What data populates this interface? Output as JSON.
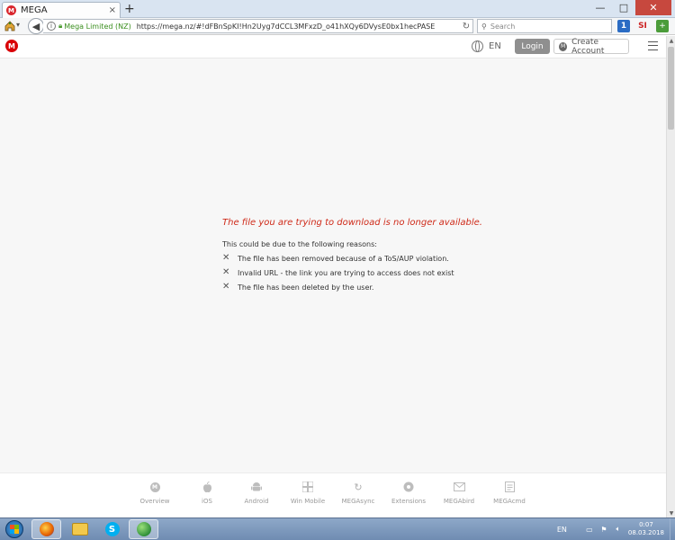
{
  "browser": {
    "tab_title": "MEGA",
    "tab_close": "×",
    "new_tab": "+",
    "window_controls": {
      "minimize": "—",
      "maximize": "□",
      "close": "✕"
    },
    "identity": "Mega Limited (NZ)",
    "url": "https://mega.nz/#!dFBnSpKI!Hn2Uyg7dCCL3MFxzD_o41hXQy6DVysE0bx1hecPASE",
    "search_placeholder": "Search",
    "ext_badge": "1",
    "ext2_label": "SI"
  },
  "site": {
    "lang": "EN",
    "login_label": "Login",
    "create_account_label": "Create Account"
  },
  "error": {
    "title": "The file you are trying to download is no longer available.",
    "intro": "This could be due to the following reasons:",
    "reasons": [
      "The file has been removed because of a ToS/AUP violation.",
      "Invalid URL - the link you are trying to access does not exist",
      "The file has been deleted by the user."
    ]
  },
  "footer": {
    "items": [
      {
        "label": "Overview",
        "icon": "mega-icon"
      },
      {
        "label": "iOS",
        "icon": "apple-icon"
      },
      {
        "label": "Android",
        "icon": "android-icon"
      },
      {
        "label": "Win Mobile",
        "icon": "windows-icon"
      },
      {
        "label": "MEGAsync",
        "icon": "sync-icon"
      },
      {
        "label": "Extensions",
        "icon": "extensions-icon"
      },
      {
        "label": "MEGAbird",
        "icon": "mail-icon"
      },
      {
        "label": "MEGAcmd",
        "icon": "terminal-icon"
      }
    ]
  },
  "taskbar": {
    "lang": "EN",
    "time": "0:07",
    "date": "08.03.2018",
    "apps": [
      "firefox-icon",
      "explorer-icon",
      "skype-icon",
      "globe-app-icon"
    ]
  },
  "colors": {
    "mega_red": "#d90007",
    "error_red": "#cf2b1a",
    "login_grey": "#8f8f8f"
  }
}
